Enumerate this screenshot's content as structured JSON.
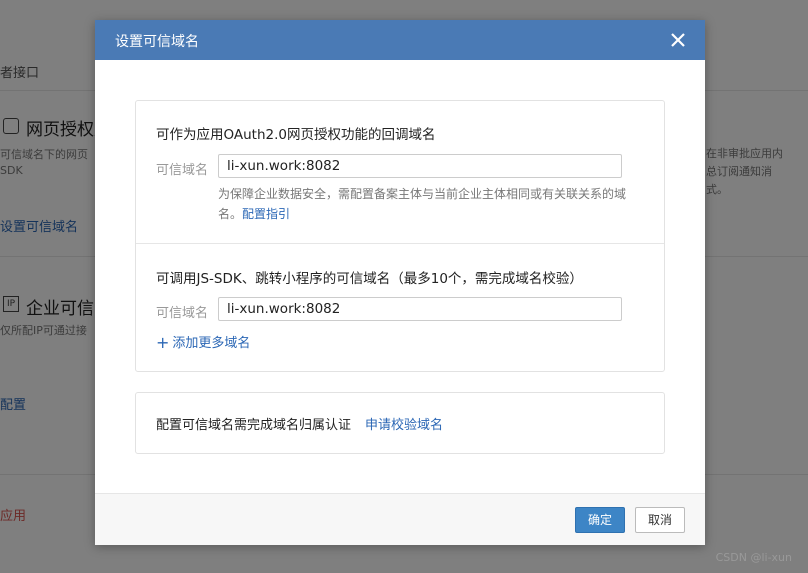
{
  "background": {
    "api_text": "者接口",
    "web_auth_title": "网页授权及",
    "web_auth_desc1": "可信域名下的网页",
    "web_auth_desc2": "SDK",
    "web_auth_link": "设置可信域名",
    "ip_icon": "IP",
    "ip_title": "企业可信I",
    "ip_desc": "仅所配IP可通过接",
    "ip_link": "配置",
    "danger_link": "应用",
    "right_text1": "在非审批应用内",
    "right_text2": "总订阅通知消",
    "right_text3": "式。"
  },
  "modal": {
    "title": "设置可信域名",
    "section1": {
      "title": "可作为应用OAuth2.0网页授权功能的回调域名",
      "field_label": "可信域名",
      "field_value": "li-xun.work:8082",
      "hint": "为保障企业数据安全，需配置备案主体与当前企业主体相同或有关联关系的域名。",
      "hint_link": "配置指引"
    },
    "section2": {
      "title": "可调用JS-SDK、跳转小程序的可信域名（最多10个，需完成域名校验）",
      "field_label": "可信域名",
      "field_value": "li-xun.work:8082",
      "add_more": "添加更多域名"
    },
    "verify": {
      "text": "配置可信域名需完成域名归属认证",
      "link": "申请校验域名"
    },
    "footer": {
      "confirm": "确定",
      "cancel": "取消"
    }
  },
  "watermark": "CSDN @li-xun",
  "colors": {
    "header": "#4a7ab5",
    "primary_button": "#3d85c6",
    "link": "#2b67b5"
  }
}
